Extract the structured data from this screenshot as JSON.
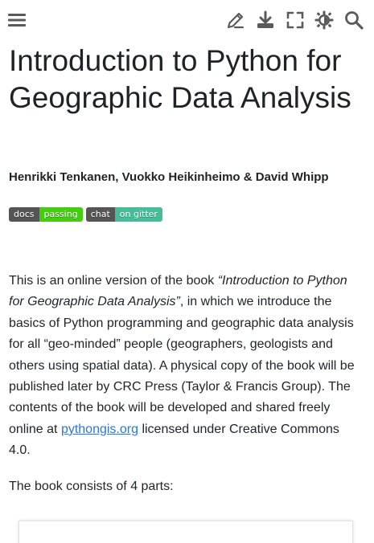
{
  "header": {
    "menu_icon": "hamburger-menu-icon",
    "edit_icon": "pencil-edit-icon",
    "download_icon": "download-icon",
    "fullscreen_icon": "fullscreen-icon",
    "theme_icon": "theme-toggle-icon",
    "search_icon": "search-icon"
  },
  "page": {
    "title": "Introduction to Python for Geographic Data Analysis",
    "authors": "Henrikki Tenkanen, Vuokko Heikinheimo & David Whipp",
    "badges": [
      {
        "left": "docs",
        "right": "passing",
        "color": "#44cc11"
      },
      {
        "left": "chat",
        "right": "on gitter",
        "color": "#46bc99"
      }
    ],
    "intro": {
      "part1": "This is an online version of the book ",
      "book_title": "“Introduction to Python for Geographic Data Analysis”",
      "part2": ", in which we introduce the basics of Python programming and geographic data analysis for all “geo-minded” people (geographers, geologists and others using spatial data). A physical copy of the book will be published later by CRC Press (Taylor & Francis Group). The contents of the book will be developed and shared freely online at ",
      "link": "pythongis.org",
      "part3": " licensed under Creative Commons 4.0."
    },
    "parts_text": "The book consists of 4 parts:"
  },
  "colors": {
    "icon": "#5a5a5a",
    "link": "#2a76dd",
    "text": "#212529"
  }
}
